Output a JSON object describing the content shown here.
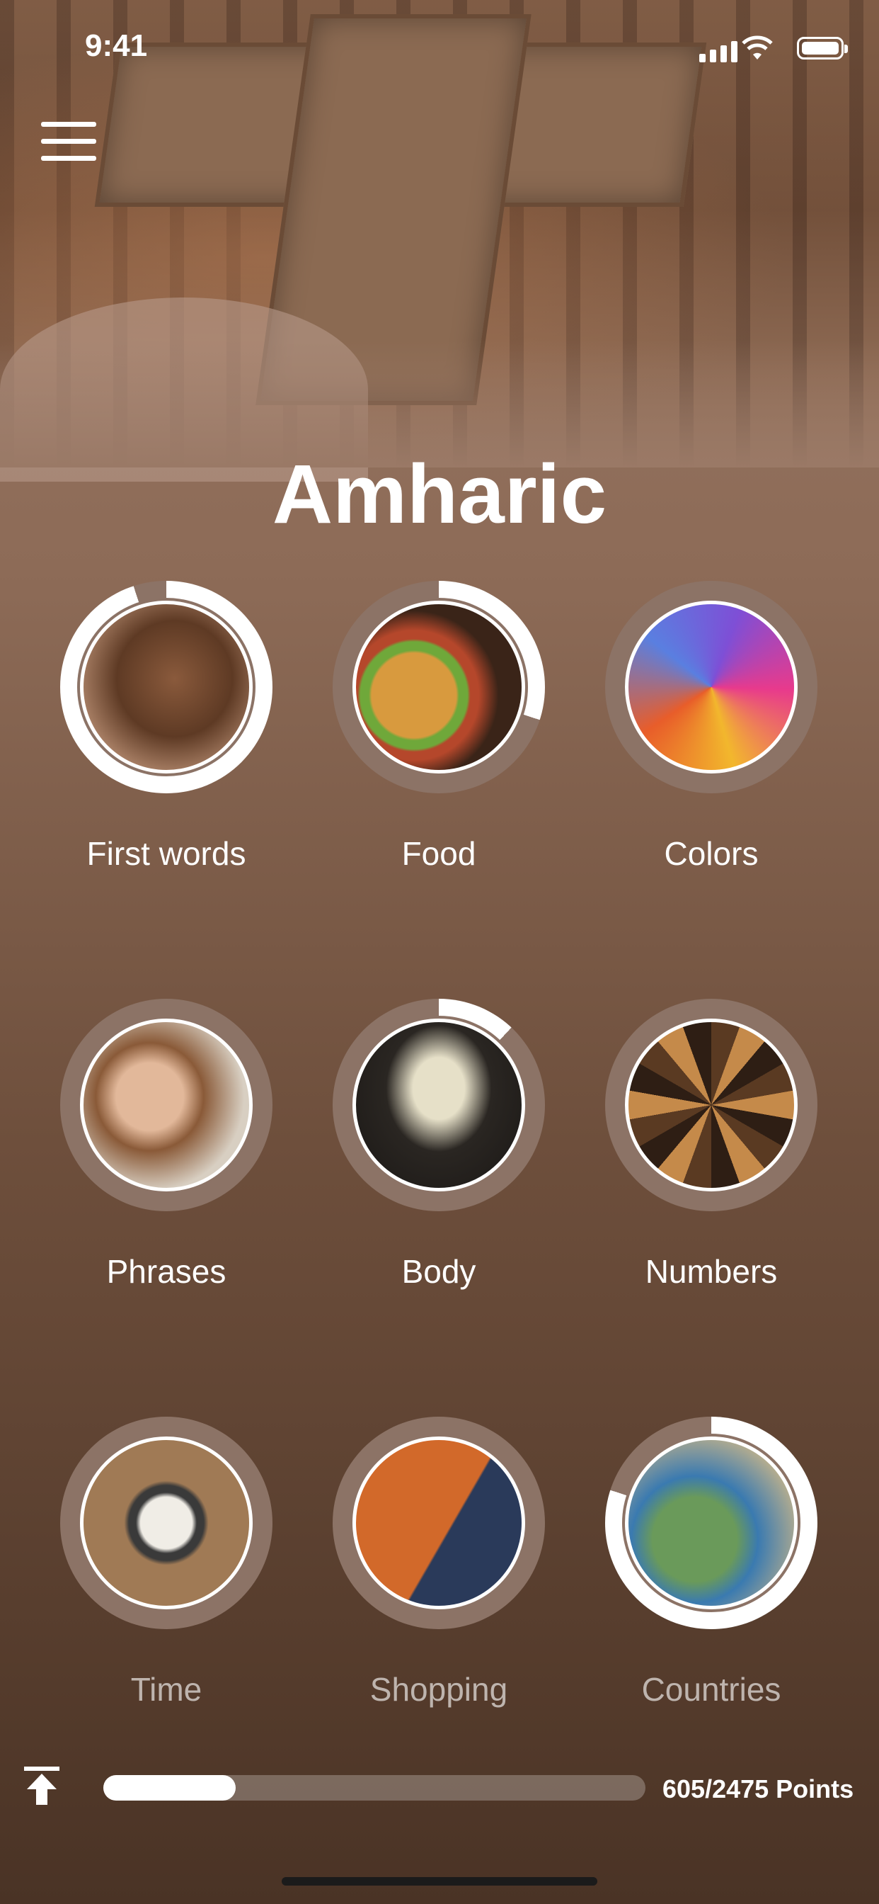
{
  "status_bar": {
    "time": "9:41"
  },
  "header": {
    "title": "Amharic"
  },
  "topics": [
    {
      "label": "First words",
      "progress": 0.95,
      "icon": "baby-face-photo",
      "dim": false
    },
    {
      "label": "Food",
      "progress": 0.3,
      "icon": "burger-photo",
      "dim": false
    },
    {
      "label": "Colors",
      "progress": 0.0,
      "icon": "color-powder-photo",
      "dim": false
    },
    {
      "label": "Phrases",
      "progress": 0.0,
      "icon": "smiling-woman-photo",
      "dim": false
    },
    {
      "label": "Body",
      "progress": 0.12,
      "icon": "skeleton-photo",
      "dim": false
    },
    {
      "label": "Numbers",
      "progress": 0.0,
      "icon": "wooden-numbers-photo",
      "dim": false
    },
    {
      "label": "Time",
      "progress": 0.0,
      "icon": "alarm-clock-photo",
      "dim": true
    },
    {
      "label": "Shopping",
      "progress": 0.0,
      "icon": "shopping-cart-photo",
      "dim": true
    },
    {
      "label": "Countries",
      "progress": 0.8,
      "icon": "map-pins-photo",
      "dim": true
    }
  ],
  "footer": {
    "points_text": "605/2475 Points",
    "points_current": 605,
    "points_total": 2475
  },
  "colors": {
    "ring_track": "#8c7366",
    "ring_fill": "#ffffff"
  }
}
